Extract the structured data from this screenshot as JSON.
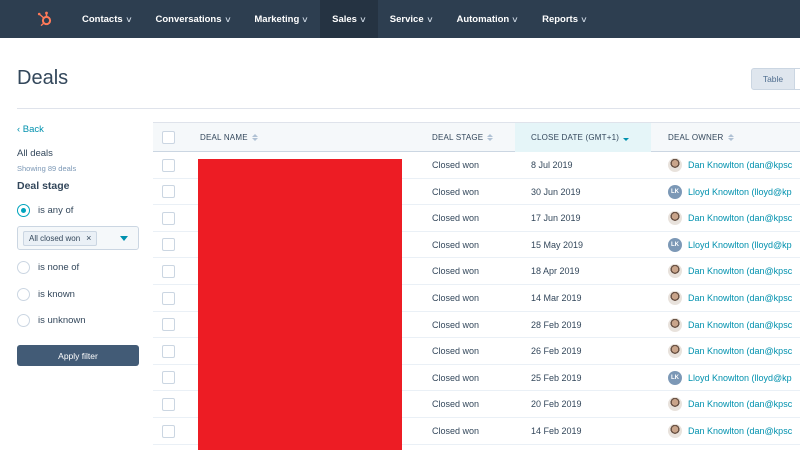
{
  "topnav": {
    "items": [
      {
        "label": "Contacts",
        "active": false
      },
      {
        "label": "Conversations",
        "active": false
      },
      {
        "label": "Marketing",
        "active": false
      },
      {
        "label": "Sales",
        "active": true
      },
      {
        "label": "Service",
        "active": false
      },
      {
        "label": "Automation",
        "active": false
      },
      {
        "label": "Reports",
        "active": false
      }
    ],
    "logo_icon": "hubspot-sprocket-icon",
    "bg_color": "#2d3e50",
    "accent_color": "#ff7a59"
  },
  "header": {
    "title": "Deals",
    "view_toggle_label": "Table"
  },
  "sidebar": {
    "back_label": "‹  Back",
    "list_name": "All deals",
    "count_text": "Showing 89 deals",
    "filter_title": "Deal stage",
    "options": [
      {
        "label": "is any of",
        "checked": true
      },
      {
        "label": "is none of",
        "checked": false
      },
      {
        "label": "is known",
        "checked": false
      },
      {
        "label": "is unknown",
        "checked": false
      }
    ],
    "selected_value": "All closed won",
    "chip_remove": "×",
    "apply_label": "Apply filter"
  },
  "table": {
    "columns": [
      {
        "label": "DEAL NAME",
        "sorted": false
      },
      {
        "label": "DEAL STAGE",
        "sorted": false
      },
      {
        "label": "CLOSE DATE (GMT+1)",
        "sorted": true
      },
      {
        "label": "DEAL OWNER",
        "sorted": false
      }
    ],
    "rows": [
      {
        "stage": "Closed won",
        "date": "8 Jul 2019",
        "owner": "Dan Knowlton (dan@kpsc",
        "avatar": "photo",
        "initials": ""
      },
      {
        "stage": "Closed won",
        "date": "30 Jun 2019",
        "owner": "Lloyd Knowlton (lloyd@kp",
        "avatar": "initials",
        "initials": "LK"
      },
      {
        "stage": "Closed won",
        "date": "17 Jun 2019",
        "owner": "Dan Knowlton (dan@kpsc",
        "avatar": "photo",
        "initials": ""
      },
      {
        "stage": "Closed won",
        "date": "15 May 2019",
        "owner": "Lloyd Knowlton (lloyd@kp",
        "avatar": "initials",
        "initials": "LK"
      },
      {
        "stage": "Closed won",
        "date": "18 Apr 2019",
        "owner": "Dan Knowlton (dan@kpsc",
        "avatar": "photo",
        "initials": ""
      },
      {
        "stage": "Closed won",
        "date": "14 Mar 2019",
        "owner": "Dan Knowlton (dan@kpsc",
        "avatar": "photo",
        "initials": ""
      },
      {
        "stage": "Closed won",
        "date": "28 Feb 2019",
        "owner": "Dan Knowlton (dan@kpsc",
        "avatar": "photo",
        "initials": ""
      },
      {
        "stage": "Closed won",
        "date": "26 Feb 2019",
        "owner": "Dan Knowlton (dan@kpsc",
        "avatar": "photo",
        "initials": ""
      },
      {
        "stage": "Closed won",
        "date": "25 Feb 2019",
        "owner": "Lloyd Knowlton (lloyd@kp",
        "avatar": "initials",
        "initials": "LK"
      },
      {
        "stage": "Closed won",
        "date": "20 Feb 2019",
        "owner": "Dan Knowlton (dan@kpsc",
        "avatar": "photo",
        "initials": ""
      },
      {
        "stage": "Closed won",
        "date": "14 Feb 2019",
        "owner": "Dan Knowlton (dan@kpsc",
        "avatar": "photo",
        "initials": ""
      }
    ]
  },
  "redaction_color": "#ed1c24"
}
